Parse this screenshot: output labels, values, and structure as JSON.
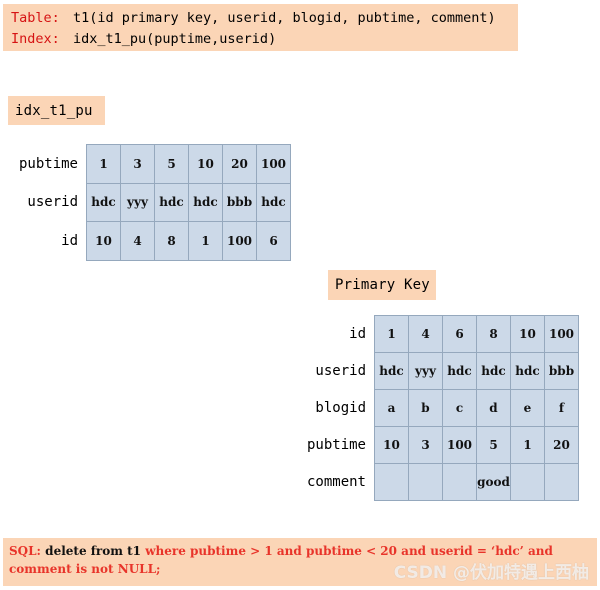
{
  "header": {
    "table_label": "Table:",
    "table_def": "t1(id primary key, userid, blogid, pubtime, comment)",
    "index_label": "Index:",
    "index_def": "idx_t1_pu(puptime,userid)"
  },
  "index_section": {
    "chip_label": "idx_t1_pu",
    "rows": [
      {
        "label": "pubtime",
        "values": [
          "1",
          "3",
          "5",
          "10",
          "20",
          "100"
        ]
      },
      {
        "label": "userid",
        "values": [
          "hdc",
          "yyy",
          "hdc",
          "hdc",
          "bbb",
          "hdc"
        ]
      },
      {
        "label": "id",
        "values": [
          "10",
          "4",
          "8",
          "1",
          "100",
          "6"
        ]
      }
    ]
  },
  "primary_key_section": {
    "chip_label": "Primary Key",
    "rows": [
      {
        "label": "id",
        "values": [
          "1",
          "4",
          "6",
          "8",
          "10",
          "100"
        ]
      },
      {
        "label": "userid",
        "values": [
          "hdc",
          "yyy",
          "hdc",
          "hdc",
          "hdc",
          "bbb"
        ]
      },
      {
        "label": "blogid",
        "values": [
          "a",
          "b",
          "c",
          "d",
          "e",
          "f"
        ]
      },
      {
        "label": "pubtime",
        "values": [
          "10",
          "3",
          "100",
          "5",
          "1",
          "20"
        ]
      },
      {
        "label": "comment",
        "values": [
          "",
          "",
          "",
          "good",
          "",
          ""
        ]
      }
    ]
  },
  "sql": {
    "prefix": "SQL:",
    "black_part": " delete from t1 ",
    "red_part": "where pubtime > 1 and pubtime < 20 and userid =  ‘hdc’ and comment is not NULL;"
  },
  "watermark": {
    "text": "CSDN @伏加特遇上西柚"
  },
  "colors": {
    "peach": "#fbd5b6",
    "cell_fill": "#ccd9e8",
    "cell_border": "#95a8bd",
    "keyword_red": "#d61414",
    "sql_red": "#e8342a"
  }
}
